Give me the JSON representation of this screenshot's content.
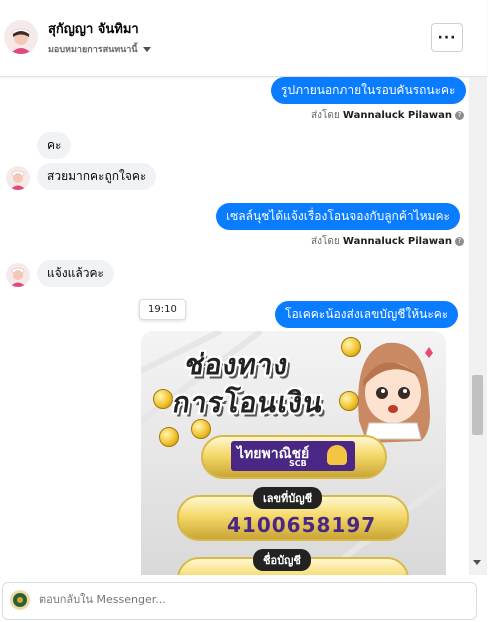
{
  "header": {
    "name": "สุกัญญา จันทิมา",
    "assign_label": "มอบหมายการสนทนานี้",
    "more_label": "···"
  },
  "messages": [
    {
      "dir": "out",
      "text": "รูปภายนอกภายในรอบคันรถนะคะ"
    },
    {
      "dir": "sent_by",
      "prefix": "ส่งโดย",
      "name": "Wannaluck Pilawan"
    },
    {
      "dir": "in",
      "text": "คะ"
    },
    {
      "dir": "in",
      "text": "สวยมากคะถูกใจคะ"
    },
    {
      "dir": "out",
      "text": "เซลล์นุชได้แจ้งเรื่องโอนจองกับลูกค้าไหมคะ"
    },
    {
      "dir": "sent_by",
      "prefix": "ส่งโดย",
      "name": "Wannaluck Pilawan"
    },
    {
      "dir": "in",
      "text": "แจ้งแล้วคะ"
    },
    {
      "dir": "out",
      "text": "โอเคคะน้องส่งเลขบัญชีให้นะคะ"
    }
  ],
  "timestamp_tooltip": "19:10",
  "promo_image": {
    "title_line1": "ช่องทาง",
    "title_line2": "การโอนเงิน",
    "bank_name": "ไทยพาณิชย์",
    "bank_code": "SCB",
    "account_label": "เลขที่บัญชี",
    "account_number": "4100658197",
    "account_name_label": "ชื่อบัญชี"
  },
  "composer": {
    "placeholder": "ตอบกลับใน Messenger..."
  },
  "colors": {
    "outgoing_bubble": "#0a7cff",
    "incoming_bubble": "#f0f2f5",
    "scb_purple": "#4b2785"
  }
}
